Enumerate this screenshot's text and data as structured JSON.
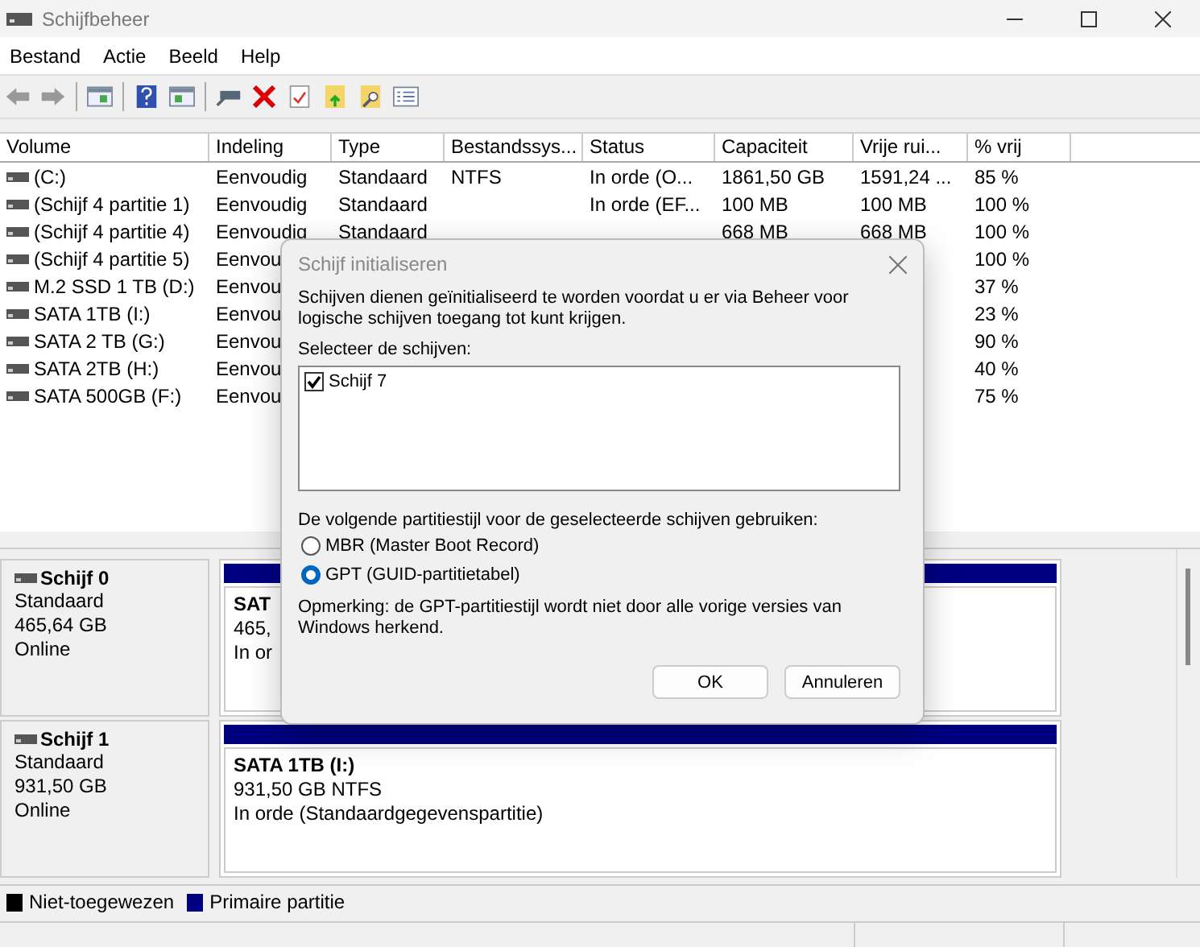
{
  "window": {
    "title": "Schijfbeheer"
  },
  "menu": [
    "Bestand",
    "Actie",
    "Beeld",
    "Help"
  ],
  "table": {
    "columns": [
      "Volume",
      "Indeling",
      "Type",
      "Bestandssys...",
      "Status",
      "Capaciteit",
      "Vrije rui...",
      "% vrij"
    ],
    "rows": [
      {
        "cells": [
          "(C:)",
          "Eenvoudig",
          "Standaard",
          "NTFS",
          "In orde (O...",
          "1861,50 GB",
          "1591,24 ...",
          "85 %"
        ]
      },
      {
        "cells": [
          "(Schijf 4 partitie 1)",
          "Eenvoudig",
          "Standaard",
          "",
          "In orde (EF...",
          "100 MB",
          "100 MB",
          "100 %"
        ]
      },
      {
        "cells": [
          "(Schijf 4 partitie 4)",
          "Eenvoudig",
          "Standaard",
          "",
          "",
          "668 MB",
          "668 MB",
          "100 %"
        ]
      },
      {
        "cells": [
          "(Schijf 4 partitie 5)",
          "Eenvou",
          "",
          "",
          "",
          "",
          "",
          "100 %"
        ]
      },
      {
        "cells": [
          "M.2 SSD 1 TB (D:)",
          "Eenvou",
          "",
          "",
          "",
          "",
          "",
          "37 %"
        ]
      },
      {
        "cells": [
          "SATA 1TB (I:)",
          "Eenvou",
          "",
          "",
          "",
          "",
          "",
          "23 %"
        ]
      },
      {
        "cells": [
          "SATA 2 TB (G:)",
          "Eenvou",
          "",
          "",
          "",
          "",
          "",
          "90 %"
        ]
      },
      {
        "cells": [
          "SATA 2TB (H:)",
          "Eenvou",
          "",
          "",
          "",
          "",
          "",
          "40 %"
        ]
      },
      {
        "cells": [
          "SATA 500GB (F:)",
          "Eenvou",
          "",
          "",
          "",
          "",
          "",
          "75 %"
        ]
      }
    ]
  },
  "disks": [
    {
      "name": "Schijf 0",
      "type": "Standaard",
      "size": "465,64 GB",
      "state": "Online",
      "partition": {
        "name": "SAT",
        "detail": "465,",
        "status": "In or"
      }
    },
    {
      "name": "Schijf 1",
      "type": "Standaard",
      "size": "931,50 GB",
      "state": "Online",
      "partition": {
        "name": "SATA 1TB  (I:)",
        "detail": "931,50 GB NTFS",
        "status": "In orde (Standaardgegevenspartitie)"
      }
    }
  ],
  "legend": [
    {
      "label": "Niet-toegewezen",
      "color": "#000000"
    },
    {
      "label": "Primaire partitie",
      "color": "#000080"
    }
  ],
  "dialog": {
    "title": "Schijf initialiseren",
    "intro": "Schijven dienen geïnitialiseerd te worden voordat u er via Beheer voor logische schijven toegang tot kunt krijgen.",
    "select_label": "Selecteer de schijven:",
    "disks": [
      {
        "label": "Schijf 7",
        "checked": true
      }
    ],
    "style_label": "De volgende partitiestijl voor de geselecteerde schijven gebruiken:",
    "styles": [
      {
        "label": "MBR (Master Boot Record)",
        "selected": false
      },
      {
        "label": "GPT (GUID-partitietabel)",
        "selected": true
      }
    ],
    "note": "Opmerking: de GPT-partitiestijl wordt niet door alle vorige versies van Windows herkend.",
    "buttons": [
      "OK",
      "Annuleren"
    ]
  }
}
